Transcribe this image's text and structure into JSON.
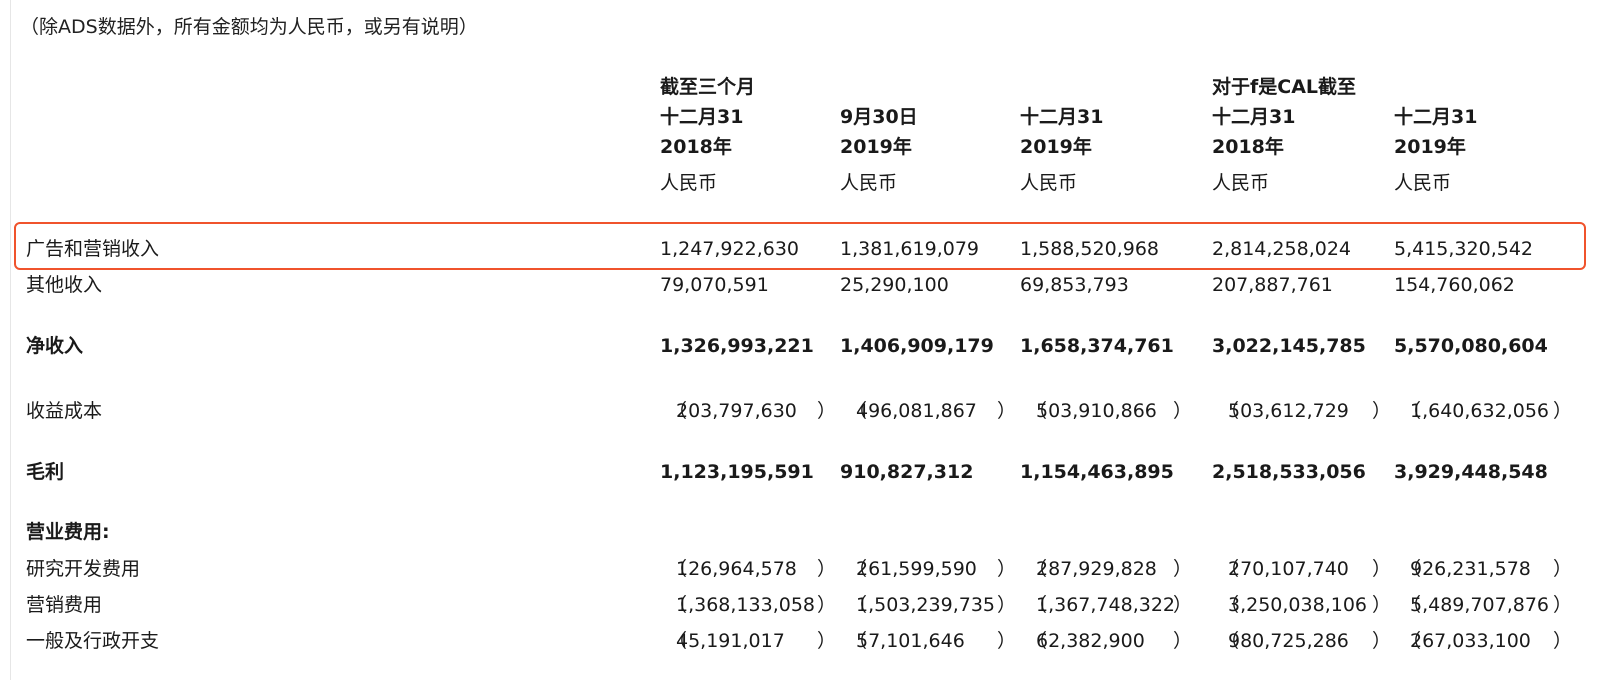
{
  "note": "（除ADS数据外，所有金额均为人民币，或另有说明）",
  "header": {
    "three_month_title": "截至三个月",
    "year_title": "对于f是CAL截至",
    "columns": [
      {
        "date": "十二月31",
        "year": "2018年",
        "currency": "人民币"
      },
      {
        "date": "9月30日",
        "year": "2019年",
        "currency": "人民币"
      },
      {
        "date": "十二月31",
        "year": "2019年",
        "currency": "人民币"
      },
      {
        "date": "十二月31",
        "year": "2018年",
        "currency": "人民币"
      },
      {
        "date": "十二月31",
        "year": "2019年",
        "currency": "人民币"
      }
    ]
  },
  "rows": [
    {
      "label": "广告和营销收入",
      "values": [
        "1,247,922,630",
        "1,381,619,079",
        "1,588,520,968",
        "2,814,258,024",
        "5,415,320,542"
      ],
      "bold": false,
      "highlighted": true
    },
    {
      "label": "其他收入",
      "values": [
        "79,070,591",
        "25,290,100",
        "69,853,793",
        "207,887,761",
        "154,760,062"
      ],
      "bold": false
    },
    {
      "label": "净收入",
      "values": [
        "1,326,993,221",
        "1,406,909,179",
        "1,658,374,761",
        "3,022,145,785",
        "5,570,080,604"
      ],
      "bold": true
    },
    {
      "label": "收益成本",
      "values": [
        "203,797,630",
        "496,081,867",
        "503,910,866",
        "503,612,729",
        "1,640,632,056"
      ],
      "bold": false,
      "negative": true
    },
    {
      "label": "毛利",
      "values": [
        "1,123,195,591",
        "910,827,312",
        "1,154,463,895",
        "2,518,533,056",
        "3,929,448,548"
      ],
      "bold": true
    },
    {
      "label": "营业费用:",
      "values": [],
      "bold": true
    },
    {
      "label": "研究开发费用",
      "values": [
        "126,964,578",
        "261,599,590",
        "287,929,828",
        "270,107,740",
        "926,231,578"
      ],
      "bold": false,
      "negative": true
    },
    {
      "label": "营销费用",
      "values": [
        "1,368,133,058",
        "1,503,239,735",
        "1,367,748,322",
        "3,250,038,106",
        "5,489,707,876"
      ],
      "bold": false,
      "negative": true
    },
    {
      "label": "一般及行政开支",
      "values": [
        "45,191,017",
        "57,101,646",
        "62,382,900",
        "980,725,286",
        "267,033,100"
      ],
      "bold": false,
      "negative": true
    }
  ],
  "paren_open": "（",
  "paren_close": "）"
}
